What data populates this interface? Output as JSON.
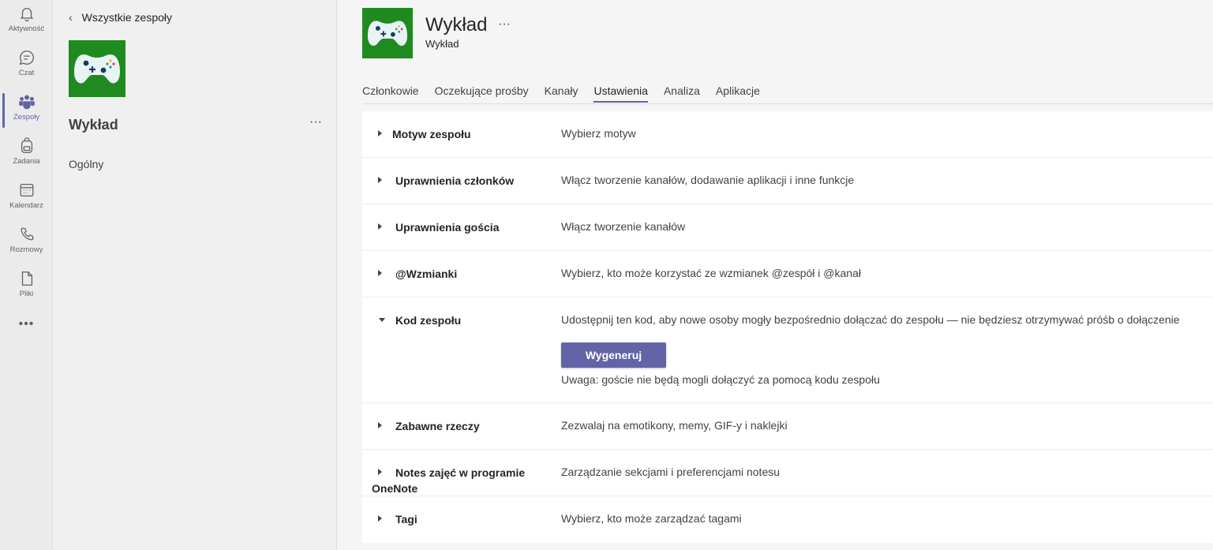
{
  "rail": {
    "items": [
      {
        "label": "Aktywność",
        "icon": "bell-icon"
      },
      {
        "label": "Czat",
        "icon": "chat-icon"
      },
      {
        "label": "Zespoły",
        "icon": "teams-icon"
      },
      {
        "label": "Zadania",
        "icon": "backpack-icon"
      },
      {
        "label": "Kalendarz",
        "icon": "calendar-icon"
      },
      {
        "label": "Rozmowy",
        "icon": "phone-icon"
      },
      {
        "label": "Pliki",
        "icon": "file-icon"
      }
    ],
    "more": "•••",
    "active": "Zespoły"
  },
  "sidebar": {
    "back_label": "Wszystkie zespoły",
    "team_name": "Wykład",
    "menu": "···",
    "channels": [
      "Ogólny"
    ]
  },
  "header": {
    "title": "Wykład",
    "menu": "···",
    "subtitle": "Wykład"
  },
  "tabs": [
    {
      "label": "Członkowie"
    },
    {
      "label": "Oczekujące prośby"
    },
    {
      "label": "Kanały"
    },
    {
      "label": "Ustawienia",
      "active": true
    },
    {
      "label": "Analiza"
    },
    {
      "label": "Aplikacje"
    }
  ],
  "settings": [
    {
      "name": "Motyw zespołu",
      "desc": "Wybierz motyw"
    },
    {
      "name": "Uprawnienia członków",
      "desc": "Włącz tworzenie kanałów, dodawanie aplikacji i inne funkcje"
    },
    {
      "name": "Uprawnienia gościa",
      "desc": "Włącz tworzenie kanałów"
    },
    {
      "name": "@Wzmianki",
      "desc": "Wybierz, kto może korzystać ze wzmianek @zespół i @kanał"
    },
    {
      "name": "Kod zespołu",
      "desc": "Udostępnij ten kod, aby nowe osoby mogły bezpośrednio dołączać do zespołu — nie będziesz otrzymywać próśb o dołączenie",
      "button": "Wygeneruj",
      "note": "Uwaga: goście nie będą mogli dołączyć za pomocą kodu zespołu"
    },
    {
      "name": "Zabawne rzeczy",
      "desc": "Zezwalaj na emotikony, memy, GIF-y i naklejki"
    },
    {
      "name": "Notes zajęć w programie OneNote",
      "desc": "Zarządzanie sekcjami i preferencjami notesu"
    },
    {
      "name": "Tagi",
      "desc": "Wybierz, kto może zarządzać tagami"
    }
  ],
  "colors": {
    "accent": "#6264a7",
    "team_logo_bg": "#1f8a1f"
  }
}
